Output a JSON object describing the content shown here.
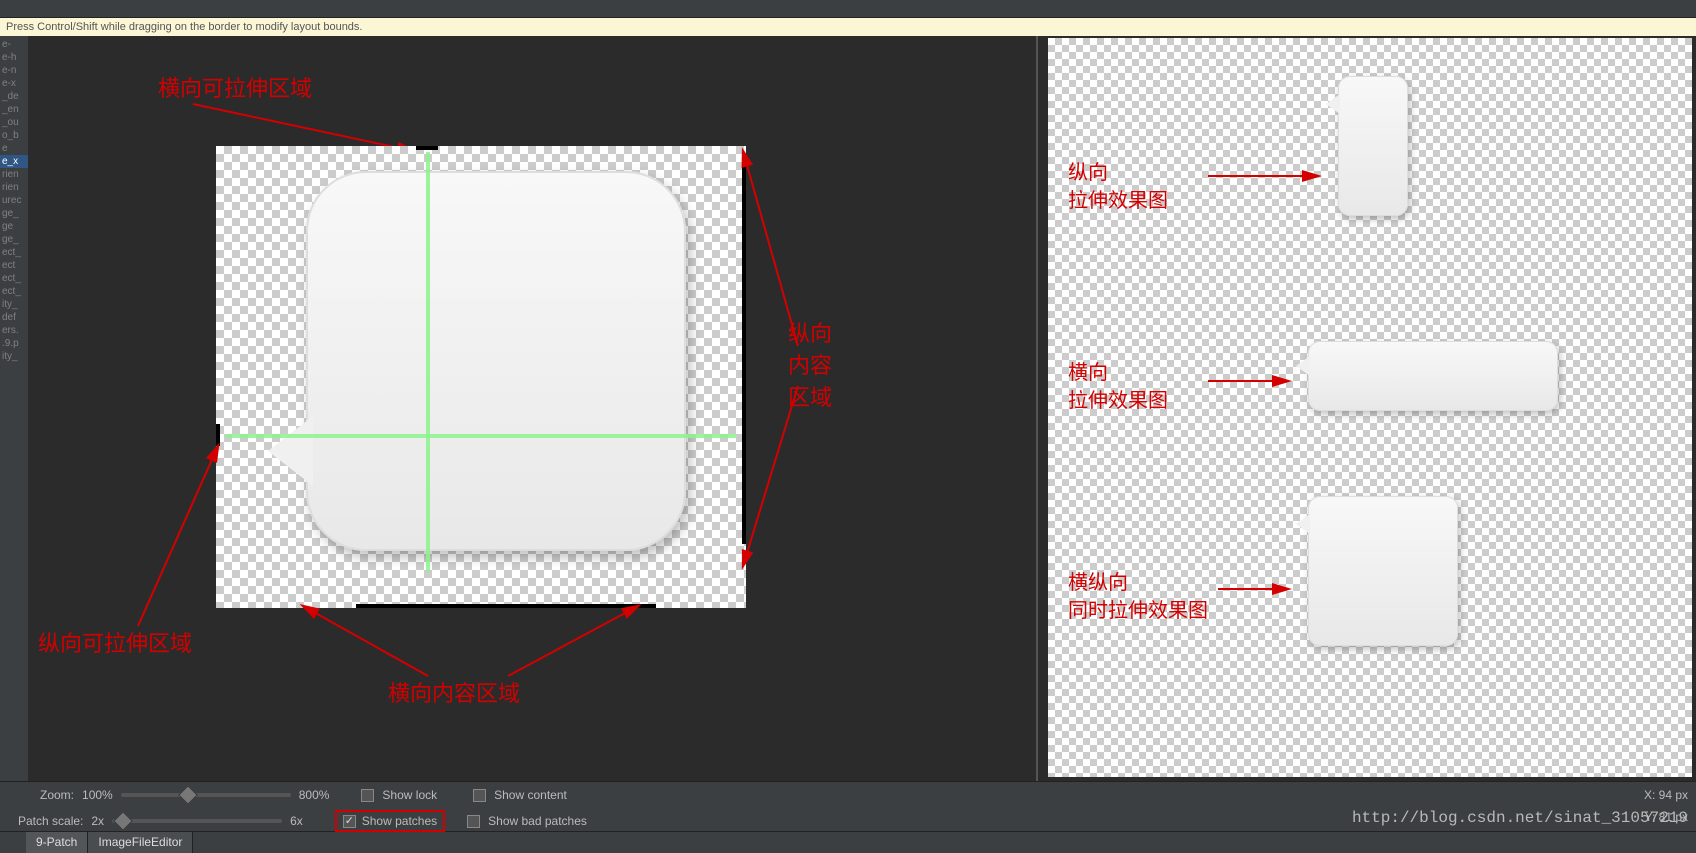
{
  "hint": "Press Control/Shift while dragging on the border to modify layout bounds.",
  "sidebar_items": [
    "",
    "e-",
    "e-h",
    "e-n",
    "e-x",
    "_de",
    "_en",
    "_ou",
    "o_b",
    "e",
    "e_x",
    "rien",
    "rien",
    "urec",
    "ge_",
    "ge",
    "ge_",
    "ect_",
    "ect",
    "ect_",
    "ect_",
    "ity_",
    "def",
    "ers.",
    ".9.p",
    "ity_"
  ],
  "sidebar_selected_index": 10,
  "annotations": {
    "h_stretch": "横向可拉伸区域",
    "v_stretch": "纵向可拉伸区域",
    "h_content": "横向内容区域",
    "v_content_l1": "纵向",
    "v_content_l2": "内容",
    "v_content_l3": "区域",
    "prev_v_l1": "纵向",
    "prev_v_l2": "拉伸效果图",
    "prev_h_l1": "横向",
    "prev_h_l2": "拉伸效果图",
    "prev_both_l1": "横纵向",
    "prev_both_l2": "同时拉伸效果图"
  },
  "controls": {
    "zoom_label": "Zoom:",
    "zoom_min": "100%",
    "zoom_max": "800%",
    "patch_label": "Patch scale:",
    "patch_min": "2x",
    "patch_max": "6x",
    "show_lock": "Show lock",
    "show_content": "Show content",
    "show_patches": "Show patches",
    "show_bad": "Show bad patches"
  },
  "coords": {
    "x_label": "X:",
    "x": "94 px",
    "y_label": "Y:",
    "y": "81 px"
  },
  "tabs": {
    "ninepatch": "9-Patch",
    "editor": "ImageFileEditor"
  },
  "watermark": "http://blog.csdn.net/sinat_31057219"
}
